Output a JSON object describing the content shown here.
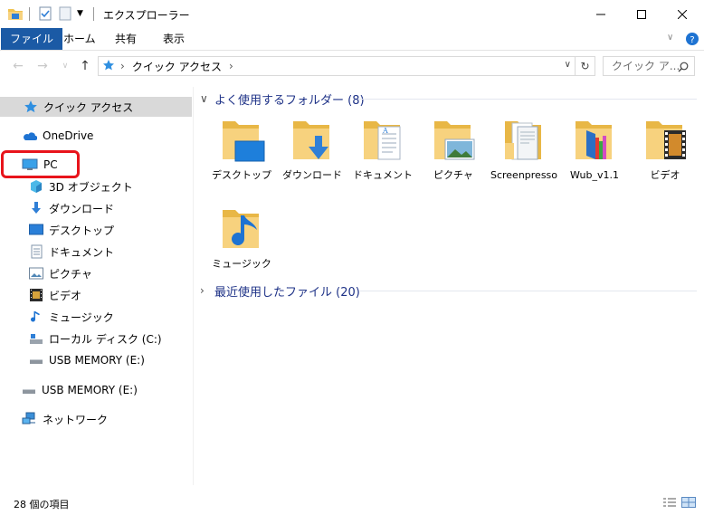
{
  "window": {
    "title": "エクスプローラー"
  },
  "ribbon": {
    "tabs": [
      "ファイル",
      "ホーム",
      "共有",
      "表示"
    ]
  },
  "address": {
    "path": "クイック アクセス",
    "search_placeholder": "クイック ア..."
  },
  "sidebar": {
    "quick_access": "クイック アクセス",
    "onedrive": "OneDrive",
    "pc": "PC",
    "pc_children": [
      "3D オブジェクト",
      "ダウンロード",
      "デスクトップ",
      "ドキュメント",
      "ピクチャ",
      "ビデオ",
      "ミュージック",
      "ローカル ディスク (C:)",
      "USB MEMORY (E:)"
    ],
    "usb": "USB MEMORY (E:)",
    "network": "ネットワーク"
  },
  "main": {
    "frequent_header": "よく使用するフォルダー (8)",
    "folders": [
      "デスクトップ",
      "ダウンロード",
      "ドキュメント",
      "ピクチャ",
      "Screenpresso",
      "Wub_v1.1",
      "ビデオ",
      "ミュージック"
    ],
    "recent_header": "最近使用したファイル (20)"
  },
  "status": {
    "item_count": "28 個の項目"
  },
  "colors": {
    "accent": "#1b5aa5",
    "highlight": "#e8141b",
    "folder": "#f7d27e",
    "group_header": "#1e3287"
  }
}
